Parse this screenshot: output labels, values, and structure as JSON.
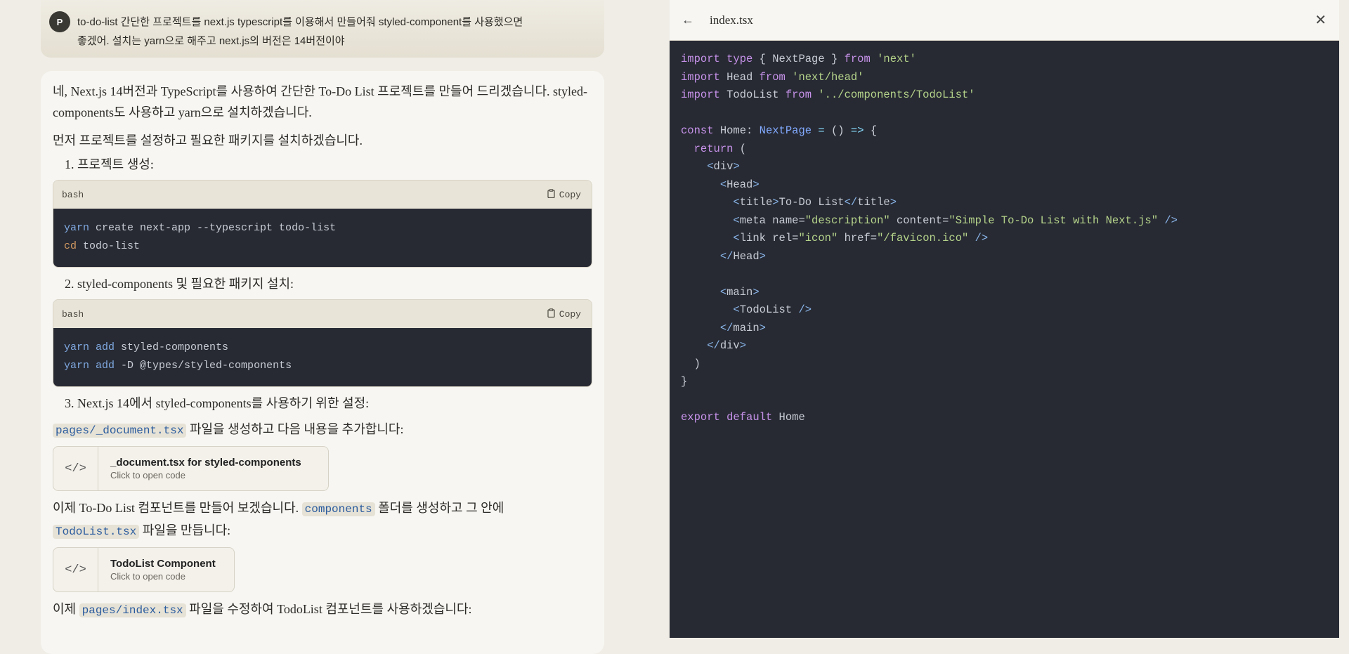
{
  "user": {
    "avatar_letter": "P",
    "message": "to-do-list 간단한 프로젝트를 next.js typescript를 이용해서 만들어줘 styled-component를 사용했으면\n좋겠어. 설치는 yarn으로 해주고 next.js의 버전은 14버전이야"
  },
  "answer": {
    "intro": "네, Next.js 14버전과 TypeScript를 사용하여 간단한 To-Do List 프로젝트를 만들어 드리겠습니다. styled-components도 사용하고 yarn으로 설치하겠습니다.",
    "setup": "먼저 프로젝트를 설정하고 필요한 패키지를 설치하겠습니다.",
    "step1": "1. 프로젝트 생성:",
    "step2": "2. styled-components 및 필요한 패키지 설치:",
    "step3": "3. Next.js 14에서 styled-components를 사용하기 위한 설정:",
    "code1": {
      "lang": "bash",
      "copy": "Copy",
      "l1_kw": "yarn",
      "l1_rest": " create next-app --typescript todo-list",
      "l2_kw": "cd",
      "l2_rest": " todo-list"
    },
    "code2": {
      "lang": "bash",
      "copy": "Copy",
      "l1_kw": "yarn",
      "l1_kw2": " add",
      "l1_rest": " styled-components",
      "l2_kw": "yarn",
      "l2_kw2": " add",
      "l2_rest": " -D @types/styled-components"
    },
    "doc_path": "pages/_document.tsx",
    "doc_after": " 파일을 생성하고 다음 내용을 추가합니다:",
    "artifact1": {
      "title": "_document.tsx for styled-components",
      "sub": "Click to open code",
      "icon": "</>"
    },
    "comp_before": "이제 To-Do List 컴포넌트를 만들어 보겠습니다. ",
    "comp_folder": "components",
    "comp_mid": " 폴더를 생성하고 그 안에",
    "comp_file": "TodoList.tsx",
    "comp_after": " 파일을 만듭니다:",
    "artifact2": {
      "title": "TodoList Component",
      "sub": "Click to open code",
      "icon": "</>"
    },
    "index_before": "이제 ",
    "index_path": "pages/index.tsx",
    "index_after": " 파일을 수정하여 TodoList 컴포넌트를 사용하겠습니다:"
  },
  "panel": {
    "filename": "index.tsx",
    "back_icon": "←",
    "close_icon": "✕"
  }
}
